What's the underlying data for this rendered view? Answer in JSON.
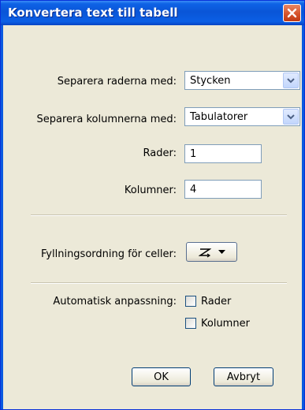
{
  "dialog": {
    "title": "Konvertera text till tabell",
    "close_icon": "close-icon"
  },
  "fields": {
    "row_separator": {
      "label": "Separera raderna med:",
      "value": "Stycken"
    },
    "column_separator": {
      "label": "Separera kolumnerna med:",
      "value": "Tabulatorer"
    },
    "rows": {
      "label": "Rader:",
      "value": "1"
    },
    "columns": {
      "label": "Kolumner:",
      "value": "4"
    },
    "fill_order": {
      "label": "Fyllningsordning för celler:",
      "icon": "z-order-icon",
      "dropdown_icon": "triangle-down-icon"
    }
  },
  "autofit": {
    "label": "Automatisk anpassning:",
    "rows": {
      "label": "Rader",
      "checked": false
    },
    "columns": {
      "label": "Kolumner",
      "checked": false
    }
  },
  "buttons": {
    "ok": "OK",
    "cancel": "Avbryt"
  },
  "colors": {
    "titlebar": "#0a55d7",
    "close": "#d6542c",
    "face": "#ece9d8"
  }
}
